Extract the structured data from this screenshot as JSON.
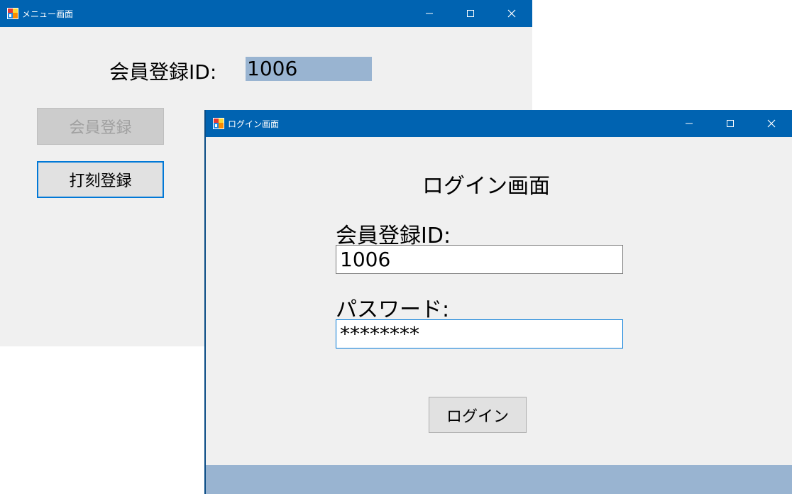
{
  "menu_window": {
    "title": "メニュー画面",
    "member_id_label": "会員登録ID:",
    "member_id_value": "1006",
    "buttons": {
      "register_member": "会員登録",
      "register_stamp": "打刻登録"
    }
  },
  "login_window": {
    "title": "ログイン画面",
    "heading": "ログイン画面",
    "member_id_label": "会員登録ID:",
    "member_id_value": "1006",
    "password_label": "パスワード:",
    "password_value": "********",
    "login_button": "ログイン"
  },
  "colors": {
    "titlebar": "#0063b1",
    "window_bg": "#f0f0f0",
    "selection": "#99b4d1",
    "focus_border": "#0078d7"
  },
  "icons": [
    "app-icon",
    "minimize-icon",
    "maximize-icon",
    "close-icon"
  ]
}
